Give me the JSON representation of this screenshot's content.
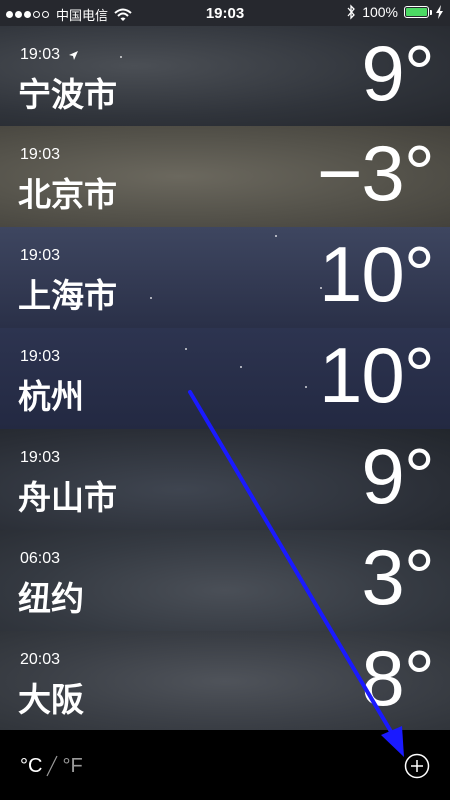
{
  "status_bar": {
    "carrier": "中国电信",
    "time": "19:03",
    "battery_percent": "100%",
    "battery_level": 1.0,
    "battery_color": "#4cd964"
  },
  "cities": [
    {
      "time": "19:03",
      "name": "宁波市",
      "temp": "9°",
      "current_location": true
    },
    {
      "time": "19:03",
      "name": "北京市",
      "temp": "−3°",
      "current_location": false
    },
    {
      "time": "19:03",
      "name": "上海市",
      "temp": "10°",
      "current_location": false
    },
    {
      "time": "19:03",
      "name": "杭州",
      "temp": "10°",
      "current_location": false
    },
    {
      "time": "19:03",
      "name": "舟山市",
      "temp": "9°",
      "current_location": false
    },
    {
      "time": "06:03",
      "name": "纽约",
      "temp": "3°",
      "current_location": false
    },
    {
      "time": "20:03",
      "name": "大阪",
      "temp": "8°",
      "current_location": false
    }
  ],
  "toolbar": {
    "unit_c": "°C",
    "unit_f": "°F",
    "selected_unit": "C"
  },
  "icons": {
    "location": "location-arrow-icon",
    "add": "plus-circle-icon",
    "wifi": "wifi-icon",
    "bluetooth": "bluetooth-icon",
    "charging": "charging-bolt-icon"
  },
  "annotation": {
    "color": "#1a1aff"
  }
}
